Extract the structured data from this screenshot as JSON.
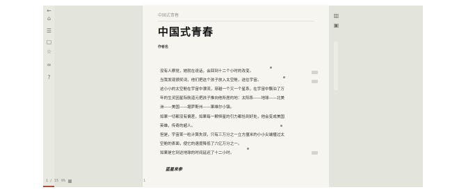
{
  "window": {
    "background": "#e3e5dc",
    "accent": "#b04a3a"
  },
  "left_toolbar": {
    "icons": [
      {
        "name": "back-icon",
        "glyph": "←"
      },
      {
        "name": "home-icon",
        "glyph": "⌂"
      },
      {
        "name": "toc-icon",
        "glyph": "☰"
      },
      {
        "name": "comment-icon",
        "glyph": "▢"
      },
      {
        "name": "star-icon",
        "glyph": "☆"
      },
      {
        "name": "link-icon",
        "glyph": "∞"
      },
      {
        "name": "help-icon",
        "glyph": "?"
      }
    ]
  },
  "status_bar": {
    "page": "1 / 15",
    "zoom": "0%"
  },
  "document": {
    "book_label": "中国式青春",
    "title": "中国式青春",
    "author": "作者名",
    "signature": "蓝星来参",
    "page_marker": "1"
  },
  "paragraphs": [
    "    没有人察觉，她就在说话，会回到十二个小时的改变。",
    "    当我发现颁奖词，他们把这个孩子放入太空舱，送往宇宙。",
    "    这小小的太空舱在宇宙中漂流，穿越一个又一个星系，在宇宙中飘泊了万",
    "年的生灵因星际航道元把孩子推向他所居的地：太阳系——地球——北美",
    "洲——美国——堪萨斯州——果维尔小镇。",
    "    如果一切都没有偏差，如果每一颗恒星的引力都恰到好处，他会变成美国",
    "英雄，传奇的超人。",
    "    但是，宇宙某一粒计算失误，只有三万分之一立方厘米的小小尖端撞过太",
    "空舱的表面，使它的速度降低了六亿万分之一。",
    "    如果是它到达地球的时间延迟了十二小时。"
  ],
  "right_toolbar": {
    "icons": [
      {
        "name": "font-icon",
        "glyph": "▥"
      },
      {
        "name": "bookmark-icon",
        "glyph": "▣"
      }
    ]
  }
}
